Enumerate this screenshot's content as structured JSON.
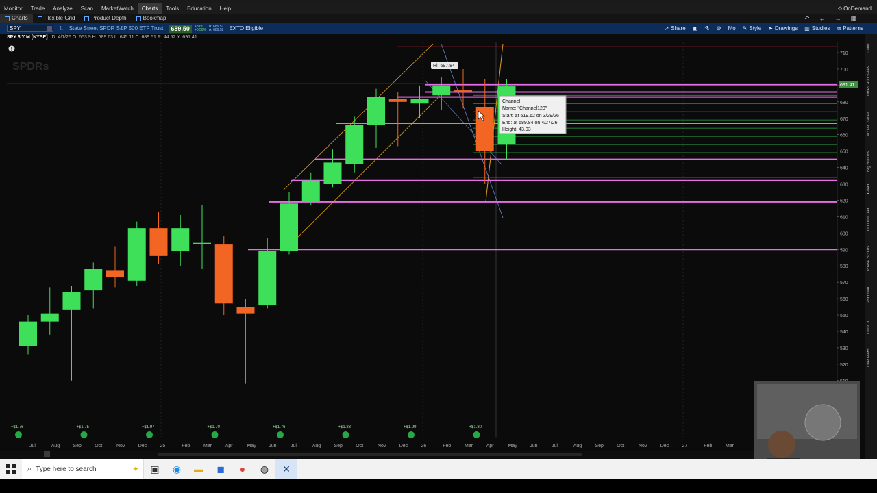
{
  "menu": {
    "items": [
      "Monitor",
      "Trade",
      "Analyze",
      "Scan",
      "MarketWatch",
      "Charts",
      "Tools",
      "Education",
      "Help"
    ],
    "active": "Charts",
    "ondemand": "OnDemand"
  },
  "subbar": {
    "items": [
      "Charts",
      "Flexible Grid",
      "Product Depth",
      "Bookmap"
    ]
  },
  "symbol": {
    "ticker": "SPY",
    "name": "State Street SPDR S&P 500 ETF Trust",
    "last": "689.50",
    "change": "+3.60",
    "change_pct": "+0.50%",
    "bid": "B: 689.51",
    "ask": "A: 689.52",
    "exto": "EXTO Eligible"
  },
  "toolbar": {
    "share": "Share",
    "mo": "Mo",
    "style": "Style",
    "drawings": "Drawings",
    "studies": "Studies",
    "patterns": "Patterns"
  },
  "chart_header": {
    "title": "SPY 3 Y M [NYSE]",
    "stats": "D: 4/1/26  O: 653.9  H: 689.63  L: 645.11  C: 689.51  R: 44.52  Y: 691.41"
  },
  "chart_data": {
    "type": "candlestick",
    "y_ticks": [
      510,
      520,
      530,
      540,
      550,
      560,
      570,
      580,
      590,
      600,
      610,
      620,
      630,
      640,
      650,
      660,
      670,
      680,
      690,
      700,
      710
    ],
    "y_range": [
      505,
      715
    ],
    "x_labels": [
      "Jul",
      "Aug",
      "Sep",
      "Oct",
      "Nov",
      "Dec",
      "25",
      "Feb",
      "Mar",
      "Apr",
      "May",
      "Jun",
      "Jul",
      "Aug",
      "Sep",
      "Oct",
      "Nov",
      "Dec",
      "26",
      "Feb",
      "Mar",
      "Apr",
      "May",
      "Jun",
      "Jul",
      "Aug",
      "Sep",
      "Oct",
      "Nov",
      "Dec",
      "27",
      "Feb",
      "Mar"
    ],
    "candles": [
      {
        "o": 531,
        "h": 542,
        "l": 526,
        "c": 546
      },
      {
        "o": 546,
        "h": 563,
        "l": 538,
        "c": 551
      },
      {
        "o": 553,
        "h": 564,
        "l": 510,
        "c": 564
      },
      {
        "o": 565,
        "h": 574,
        "l": 554,
        "c": 578
      },
      {
        "o": 577,
        "h": 588,
        "l": 567,
        "c": 573
      },
      {
        "o": 571,
        "h": 600,
        "l": 568,
        "c": 603
      },
      {
        "o": 603,
        "h": 609,
        "l": 581,
        "c": 586
      },
      {
        "o": 589,
        "h": 607,
        "l": 580,
        "c": 603
      },
      {
        "o": 594,
        "h": 613,
        "l": 578,
        "c": 594
      },
      {
        "o": 593,
        "h": 594,
        "l": 550,
        "c": 557
      },
      {
        "o": 555,
        "h": 556,
        "l": 508,
        "c": 551
      },
      {
        "o": 556,
        "h": 593,
        "l": 554,
        "c": 589
      },
      {
        "o": 589,
        "h": 621,
        "l": 587,
        "c": 618
      },
      {
        "o": 619,
        "h": 633,
        "l": 617,
        "c": 632
      },
      {
        "o": 630,
        "h": 647,
        "l": 628,
        "c": 643
      },
      {
        "o": 642,
        "h": 667,
        "l": 637,
        "c": 666
      },
      {
        "o": 666,
        "h": 684,
        "l": 652,
        "c": 683
      },
      {
        "o": 682,
        "h": 682,
        "l": 653,
        "c": 680
      },
      {
        "o": 679,
        "h": 686,
        "l": 670,
        "c": 682
      },
      {
        "o": 684,
        "h": 691,
        "l": 675,
        "c": 690
      },
      {
        "o": 687,
        "h": 696,
        "l": 676,
        "c": 686
      },
      {
        "o": 677,
        "h": 690,
        "l": 630,
        "c": 650
      },
      {
        "o": 654,
        "h": 690,
        "l": 645,
        "c": 689.5
      }
    ],
    "hi_label": "Hi: 697.84",
    "price_tag": "691.41",
    "dividends": [
      "+$1.76",
      "+$1.75",
      "+$1.97",
      "+$1.70",
      "+$1.76",
      "+$1.83",
      "+$1.99",
      "+$1.80"
    ],
    "horizontal_lines": {
      "magenta": [
        690.5,
        686,
        683,
        667,
        645,
        632,
        619,
        590
      ],
      "green": [
        684,
        679,
        674,
        669,
        664,
        659,
        654,
        649,
        634
      ],
      "red": [
        697
      ]
    }
  },
  "tooltip": {
    "title": "Channel",
    "name": "Name: \"Channel120\"",
    "start": "Start: at 619.62 on 3/29/26",
    "end": "End: at 689.84 on 4/27/26",
    "height": "Height: 43.03"
  },
  "sidebar": {
    "tabs": [
      "Trade",
      "Times And Sales",
      "Active Trader",
      "Big Buttons",
      "Chart",
      "Option Chain",
      "Phase Scores",
      "Dashboard",
      "Level II",
      "Live News"
    ]
  },
  "taskbar": {
    "search_placeholder": "Type here to search"
  },
  "colors": {
    "bull": "#3ee05a",
    "bear": "#f26522",
    "magenta": "#e86ce8",
    "green_line": "#2fa84a",
    "orange_line": "#e0a020",
    "blue_line": "#6a84c8"
  }
}
